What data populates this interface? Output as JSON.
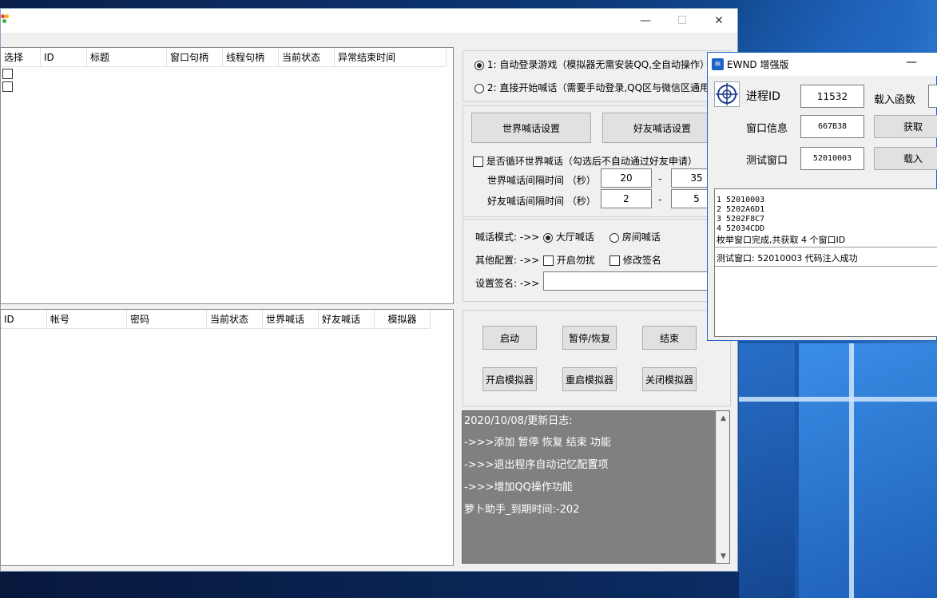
{
  "main": {
    "grid1": {
      "columns": [
        "选择",
        "ID",
        "标题",
        "窗口句柄",
        "线程句柄",
        "当前状态",
        "异常结束时间"
      ]
    },
    "grid2": {
      "columns": [
        "ID",
        "帐号",
        "密码",
        "当前状态",
        "世界喊话",
        "好友喊话",
        "模拟器"
      ]
    },
    "mode": {
      "option1": "1: 自动登录游戏（模拟器无需安装QQ,全自动操作）",
      "option2": "2: 直接开始喊话（需要手动登录,QQ区与微信区通用"
    },
    "shout": {
      "world_button": "世界喊话设置",
      "friend_button": "好友喊话设置",
      "loop_label": "是否循环世界喊话（勾选后不自动通过好友申请）",
      "world_interval_label": "世界喊话间隔时间 （秒）",
      "world_min": "20",
      "world_max": "35",
      "friend_interval_label": "好友喊话间隔时间 （秒）",
      "friend_min": "2",
      "friend_max": "5",
      "dash": "-"
    },
    "config": {
      "mode_label": "喊话模式: ->>",
      "lobby": "大厅喊话",
      "room": "房间喊话",
      "other_label": "其他配置: ->>",
      "dnd": "开启勿扰",
      "sign": "修改签名",
      "sign_label": "设置签名: ->>"
    },
    "controls": {
      "start": "启动",
      "pause": "暂停/恢复",
      "stop": "结束",
      "open_emu": "开启模拟器",
      "restart_emu": "重启模拟器",
      "close_emu": "关闭模拟器"
    },
    "log": [
      "2020/10/08/更新日志:",
      "->>>添加 暂停 恢复 结束 功能",
      "->>>退出程序自动记忆配置项",
      "->>>增加QQ操作功能",
      "萝卜助手_到期时间:-202"
    ]
  },
  "ewnd": {
    "title": "EWND 增强版",
    "pid_label": "进程ID",
    "pid_value": "11532",
    "load_func_label": "载入函数",
    "wininfo_label": "窗口信息",
    "wininfo_value": "667B38",
    "get_button": "获取",
    "test_label": "测试窗口",
    "test_value": "52010003",
    "load_button": "载入",
    "list": [
      "1 52010003",
      "2 5202A6D1",
      "3 5202F8C7",
      "4 52034CDD",
      "枚举窗口完成,共获取 4 个窗口ID",
      "测试窗口: 52010003 代码注入成功"
    ]
  }
}
